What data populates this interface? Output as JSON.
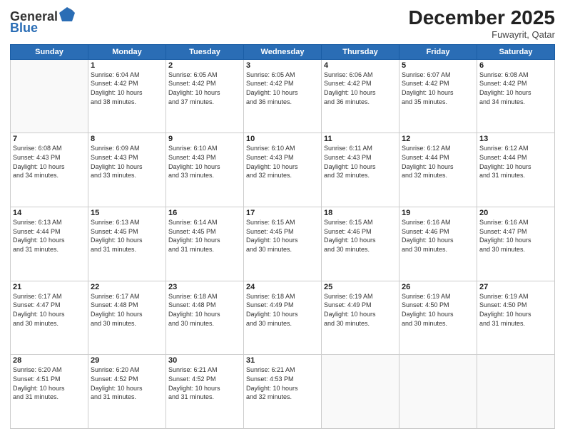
{
  "header": {
    "logo_general": "General",
    "logo_blue": "Blue",
    "month_title": "December 2025",
    "location": "Fuwayrit, Qatar"
  },
  "calendar": {
    "days_of_week": [
      "Sunday",
      "Monday",
      "Tuesday",
      "Wednesday",
      "Thursday",
      "Friday",
      "Saturday"
    ],
    "weeks": [
      [
        {
          "day": "",
          "info": ""
        },
        {
          "day": "1",
          "info": "Sunrise: 6:04 AM\nSunset: 4:42 PM\nDaylight: 10 hours\nand 38 minutes."
        },
        {
          "day": "2",
          "info": "Sunrise: 6:05 AM\nSunset: 4:42 PM\nDaylight: 10 hours\nand 37 minutes."
        },
        {
          "day": "3",
          "info": "Sunrise: 6:05 AM\nSunset: 4:42 PM\nDaylight: 10 hours\nand 36 minutes."
        },
        {
          "day": "4",
          "info": "Sunrise: 6:06 AM\nSunset: 4:42 PM\nDaylight: 10 hours\nand 36 minutes."
        },
        {
          "day": "5",
          "info": "Sunrise: 6:07 AM\nSunset: 4:42 PM\nDaylight: 10 hours\nand 35 minutes."
        },
        {
          "day": "6",
          "info": "Sunrise: 6:08 AM\nSunset: 4:42 PM\nDaylight: 10 hours\nand 34 minutes."
        }
      ],
      [
        {
          "day": "7",
          "info": "Sunrise: 6:08 AM\nSunset: 4:43 PM\nDaylight: 10 hours\nand 34 minutes."
        },
        {
          "day": "8",
          "info": "Sunrise: 6:09 AM\nSunset: 4:43 PM\nDaylight: 10 hours\nand 33 minutes."
        },
        {
          "day": "9",
          "info": "Sunrise: 6:10 AM\nSunset: 4:43 PM\nDaylight: 10 hours\nand 33 minutes."
        },
        {
          "day": "10",
          "info": "Sunrise: 6:10 AM\nSunset: 4:43 PM\nDaylight: 10 hours\nand 32 minutes."
        },
        {
          "day": "11",
          "info": "Sunrise: 6:11 AM\nSunset: 4:43 PM\nDaylight: 10 hours\nand 32 minutes."
        },
        {
          "day": "12",
          "info": "Sunrise: 6:12 AM\nSunset: 4:44 PM\nDaylight: 10 hours\nand 32 minutes."
        },
        {
          "day": "13",
          "info": "Sunrise: 6:12 AM\nSunset: 4:44 PM\nDaylight: 10 hours\nand 31 minutes."
        }
      ],
      [
        {
          "day": "14",
          "info": "Sunrise: 6:13 AM\nSunset: 4:44 PM\nDaylight: 10 hours\nand 31 minutes."
        },
        {
          "day": "15",
          "info": "Sunrise: 6:13 AM\nSunset: 4:45 PM\nDaylight: 10 hours\nand 31 minutes."
        },
        {
          "day": "16",
          "info": "Sunrise: 6:14 AM\nSunset: 4:45 PM\nDaylight: 10 hours\nand 31 minutes."
        },
        {
          "day": "17",
          "info": "Sunrise: 6:15 AM\nSunset: 4:45 PM\nDaylight: 10 hours\nand 30 minutes."
        },
        {
          "day": "18",
          "info": "Sunrise: 6:15 AM\nSunset: 4:46 PM\nDaylight: 10 hours\nand 30 minutes."
        },
        {
          "day": "19",
          "info": "Sunrise: 6:16 AM\nSunset: 4:46 PM\nDaylight: 10 hours\nand 30 minutes."
        },
        {
          "day": "20",
          "info": "Sunrise: 6:16 AM\nSunset: 4:47 PM\nDaylight: 10 hours\nand 30 minutes."
        }
      ],
      [
        {
          "day": "21",
          "info": "Sunrise: 6:17 AM\nSunset: 4:47 PM\nDaylight: 10 hours\nand 30 minutes."
        },
        {
          "day": "22",
          "info": "Sunrise: 6:17 AM\nSunset: 4:48 PM\nDaylight: 10 hours\nand 30 minutes."
        },
        {
          "day": "23",
          "info": "Sunrise: 6:18 AM\nSunset: 4:48 PM\nDaylight: 10 hours\nand 30 minutes."
        },
        {
          "day": "24",
          "info": "Sunrise: 6:18 AM\nSunset: 4:49 PM\nDaylight: 10 hours\nand 30 minutes."
        },
        {
          "day": "25",
          "info": "Sunrise: 6:19 AM\nSunset: 4:49 PM\nDaylight: 10 hours\nand 30 minutes."
        },
        {
          "day": "26",
          "info": "Sunrise: 6:19 AM\nSunset: 4:50 PM\nDaylight: 10 hours\nand 30 minutes."
        },
        {
          "day": "27",
          "info": "Sunrise: 6:19 AM\nSunset: 4:50 PM\nDaylight: 10 hours\nand 31 minutes."
        }
      ],
      [
        {
          "day": "28",
          "info": "Sunrise: 6:20 AM\nSunset: 4:51 PM\nDaylight: 10 hours\nand 31 minutes."
        },
        {
          "day": "29",
          "info": "Sunrise: 6:20 AM\nSunset: 4:52 PM\nDaylight: 10 hours\nand 31 minutes."
        },
        {
          "day": "30",
          "info": "Sunrise: 6:21 AM\nSunset: 4:52 PM\nDaylight: 10 hours\nand 31 minutes."
        },
        {
          "day": "31",
          "info": "Sunrise: 6:21 AM\nSunset: 4:53 PM\nDaylight: 10 hours\nand 32 minutes."
        },
        {
          "day": "",
          "info": ""
        },
        {
          "day": "",
          "info": ""
        },
        {
          "day": "",
          "info": ""
        }
      ]
    ]
  }
}
